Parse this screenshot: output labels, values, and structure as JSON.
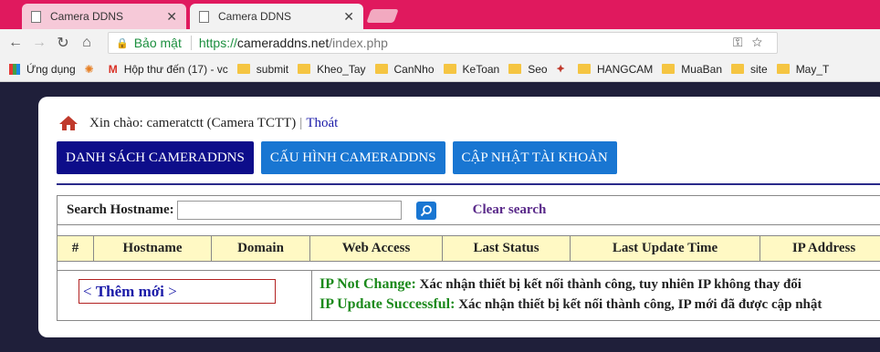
{
  "browser": {
    "tabs": [
      {
        "title": "Camera DDNS",
        "active": false
      },
      {
        "title": "Camera DDNS",
        "active": true
      }
    ],
    "secure_label": "Bảo mật",
    "url_scheme": "https://",
    "url_host": "cameraddns.net",
    "url_path": "/index.php",
    "bookmarks": [
      "Ứng dụng",
      "Hộp thư đến (17) - vc",
      "submit",
      "Kheo_Tay",
      "CanNho",
      "KeToan",
      "Seo",
      "HANGCAM",
      "MuaBan",
      "site",
      "May_T"
    ]
  },
  "page": {
    "greeting": "Xin chào: cameratctt (Camera TCTT)",
    "separator": "|",
    "logout": "Thoát",
    "nav_tabs": [
      {
        "label": "DANH SÁCH CAMERADDNS",
        "active": true
      },
      {
        "label": "CẤU HÌNH CAMERADDNS",
        "active": false
      },
      {
        "label": "CẬP NHẬT TÀI KHOẢN",
        "active": false
      }
    ],
    "search": {
      "label": "Search Hostname:",
      "value": "",
      "clear": "Clear search"
    },
    "columns": [
      "#",
      "Hostname",
      "Domain",
      "Web Access",
      "Last Status",
      "Last Update Time",
      "IP Address"
    ],
    "add_new": {
      "left": "<",
      "label": "Thêm mới",
      "right": ">"
    },
    "legend": [
      {
        "status": "IP Not Change:",
        "desc": "Xác nhận thiết bị kết nối thành công, tuy nhiên IP không thay đổi"
      },
      {
        "status": "IP Update Successful:",
        "desc": "Xác nhận thiết bị kết nối thành công, IP mới đã được cập nhật"
      }
    ]
  },
  "colors": {
    "accent": "#1976d2",
    "active_tab": "#0d0d8a",
    "header_bg": "#fff9c4",
    "status_green": "#1c8a1c"
  }
}
